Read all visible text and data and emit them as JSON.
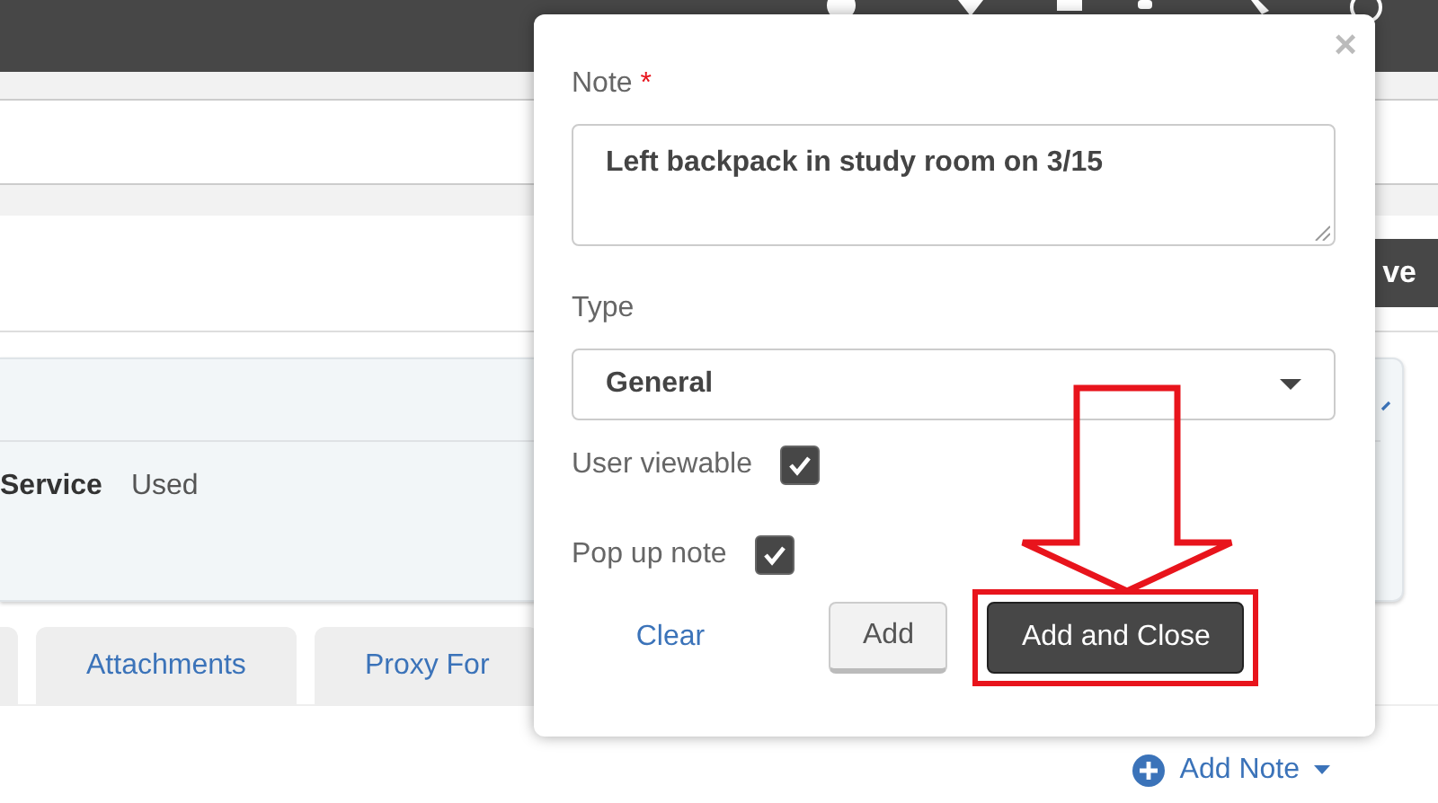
{
  "background": {
    "save_button": "ve",
    "service_label": "Service",
    "service_value": "Used",
    "tabs": [
      {
        "label": "Attachments",
        "selected": false
      },
      {
        "label": "Proxy For",
        "selected": false
      }
    ],
    "add_note": "Add Note"
  },
  "dialog": {
    "close": "×",
    "note_label": "Note",
    "required_mark": "*",
    "note_value": "Left backpack in study room on 3/15",
    "type_label": "Type",
    "type_value": "General",
    "checkboxes": [
      {
        "label": "User viewable",
        "checked": true
      },
      {
        "label": "Pop up note",
        "checked": true
      }
    ],
    "clear": "Clear",
    "add": "Add",
    "add_and_close": "Add and Close",
    "highlight": true
  }
}
